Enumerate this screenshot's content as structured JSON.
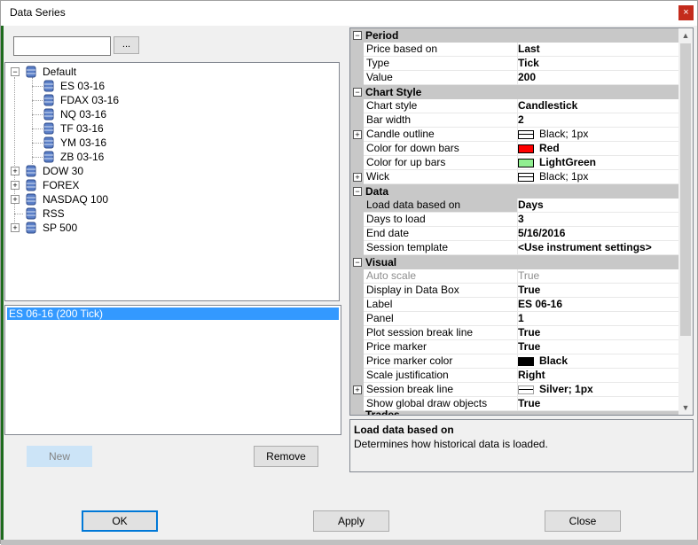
{
  "window": {
    "title": "Data Series",
    "close_glyph": "×"
  },
  "search": {
    "value": "",
    "browse_label": "..."
  },
  "tree": {
    "default": {
      "label": "Default",
      "expand": "−"
    },
    "children": [
      "ES 03-16",
      "FDAX 03-16",
      "NQ 03-16",
      "TF 03-16",
      "YM 03-16",
      "ZB 03-16"
    ],
    "groups": [
      {
        "label": "DOW 30",
        "expand": "+"
      },
      {
        "label": "FOREX",
        "expand": "+"
      },
      {
        "label": "NASDAQ 100",
        "expand": "+"
      },
      {
        "label": "RSS",
        "expand": ""
      },
      {
        "label": "SP 500",
        "expand": "+"
      }
    ]
  },
  "series": {
    "selected": "ES 06-16 (200 Tick)"
  },
  "buttons": {
    "new": "New",
    "remove": "Remove",
    "ok": "OK",
    "apply": "Apply",
    "close": "Close"
  },
  "properties": {
    "period": {
      "header": "Period",
      "rows": [
        {
          "name": "Price based on",
          "value": "Last"
        },
        {
          "name": "Type",
          "value": "Tick"
        },
        {
          "name": "Value",
          "value": "200"
        }
      ]
    },
    "chart_style": {
      "header": "Chart Style",
      "rows": [
        {
          "name": "Chart style",
          "value": "Candlestick"
        },
        {
          "name": "Bar width",
          "value": "2"
        },
        {
          "name": "Candle outline",
          "value": "Black; 1px",
          "expand": "+"
        },
        {
          "name": "Color for down bars",
          "value": "Red",
          "color": "#ff0000"
        },
        {
          "name": "Color for up bars",
          "value": "LightGreen",
          "color": "#90ee90"
        },
        {
          "name": "Wick",
          "value": "Black; 1px",
          "expand": "+"
        }
      ]
    },
    "data": {
      "header": "Data",
      "rows": [
        {
          "name": "Load data based on",
          "value": "Days"
        },
        {
          "name": "Days to load",
          "value": "3"
        },
        {
          "name": "End date",
          "value": "5/16/2016"
        },
        {
          "name": "Session template",
          "value": "<Use instrument settings>"
        }
      ]
    },
    "visual": {
      "header": "Visual",
      "rows": [
        {
          "name": "Auto scale",
          "value": "True"
        },
        {
          "name": "Display in Data Box",
          "value": "True"
        },
        {
          "name": "Label",
          "value": "ES 06-16"
        },
        {
          "name": "Panel",
          "value": "1"
        },
        {
          "name": "Plot session break line",
          "value": "True"
        },
        {
          "name": "Price marker",
          "value": "True"
        },
        {
          "name": "Price marker color",
          "value": "Black",
          "color": "#000000"
        },
        {
          "name": "Scale justification",
          "value": "Right"
        },
        {
          "name": "Session break line",
          "value": "Silver; 1px",
          "expand": "+"
        },
        {
          "name": "Show global draw objects",
          "value": "True"
        }
      ]
    },
    "next_header": "Trades"
  },
  "help": {
    "title": "Load data based on",
    "description": "Determines how historical data is loaded."
  }
}
